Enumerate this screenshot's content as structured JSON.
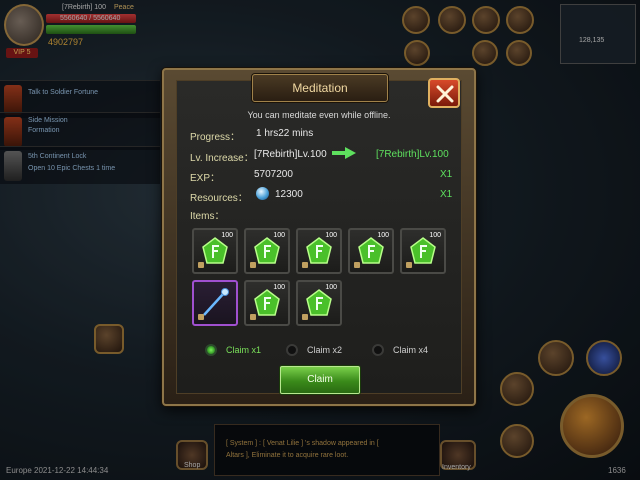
{
  "hud": {
    "player_name": "[7Rebirth] 100",
    "rebirth_label": "Peace",
    "hp_text": "5560640 / 5560640",
    "vip_label": "VIP 5",
    "power_value": "4902797",
    "side_quests": [
      {
        "line1": "Talk to Soldier Fortune",
        "line2": ""
      },
      {
        "line1": "Side Mission",
        "line2": "Formation"
      },
      {
        "line1": "5th Continent Lock",
        "line2": "Open 10 Epic Chests 1 time"
      }
    ],
    "top_icons": [
      "Super Deal",
      "Artifacts",
      "Daily Purchase",
      "Festival",
      "Arena",
      "Forge",
      "Dungeon"
    ],
    "minimap_coords": "128,135",
    "chat_line1": "[ System ] : [ Venat Lilie ] 's shadow appeared in [",
    "chat_line2": "Altars ], Eliminate it to acquire rare loot.",
    "server_time": "Europe 2021-12-22 14:44:34",
    "bottom_right_value": "1636",
    "shop_label": "Shop",
    "inventory_label": "Inventory"
  },
  "dialog": {
    "title": "Meditation",
    "subtitle": "You can meditate even while offline.",
    "progress_label": "Progress：",
    "progress_value": "1 hrs22 mins",
    "level_label": "Lv. Increase：",
    "level_from": "[7Rebirth]Lv.100",
    "level_to": "[7Rebirth]Lv.100",
    "exp_label": "EXP：",
    "exp_value": "5707200",
    "exp_multiplier": "X1",
    "resources_label": "Resources：",
    "resources_value": "12300",
    "resources_multiplier": "X1",
    "items_label": "Items：",
    "items": [
      {
        "type": "exp-crystal",
        "qty": "100",
        "selected": false
      },
      {
        "type": "exp-crystal",
        "qty": "100",
        "selected": false
      },
      {
        "type": "exp-crystal",
        "qty": "100",
        "selected": false
      },
      {
        "type": "exp-crystal",
        "qty": "100",
        "selected": false
      },
      {
        "type": "exp-crystal",
        "qty": "100",
        "selected": false
      },
      {
        "type": "staff-weapon",
        "qty": "",
        "selected": true
      },
      {
        "type": "exp-crystal",
        "qty": "100",
        "selected": false
      },
      {
        "type": "exp-crystal",
        "qty": "100",
        "selected": false
      }
    ],
    "claim_options": [
      {
        "label": "Claim x1",
        "selected": true
      },
      {
        "label": "Claim x2",
        "selected": false
      },
      {
        "label": "Claim x4",
        "selected": false
      }
    ],
    "claim_button": "Claim"
  },
  "colors": {
    "accent_green": "#5ee05e",
    "title_gold": "#f1d9a2",
    "close_red": "#d84a2a"
  }
}
